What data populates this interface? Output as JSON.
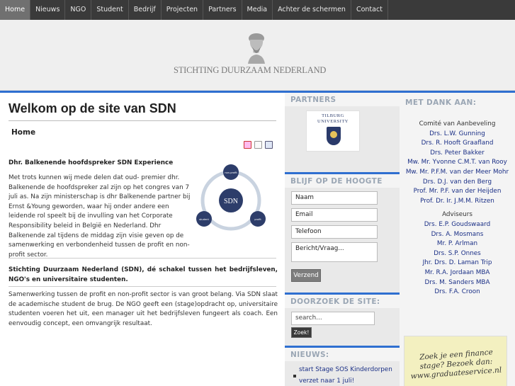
{
  "nav": {
    "items": [
      "Home",
      "Nieuws",
      "NGO",
      "Student",
      "Bedrijf",
      "Projecten",
      "Partners",
      "Media",
      "Achter de schermen",
      "Contact"
    ],
    "active_index": 0
  },
  "header": {
    "logo_text": "STICHTING DUURZAAM NEDERLAND"
  },
  "main": {
    "title": "Welkom op de site van SDN",
    "breadcrumb": "Home",
    "tool_icons": [
      "pdf-icon",
      "print-icon",
      "email-icon"
    ],
    "article_heading": "Dhr. Balkenende hoofdspreker SDN Experience",
    "article_body": "Met trots kunnen wij mede delen dat oud- premier dhr. Balkenende de hoofdspreker zal zijn op het congres van 7 juli as. Na zijn ministerschap is dhr Balkenende partner bij Ernst &Young geworden, waar hij onder andere een leidende rol speelt bij de invulling van het Corporate Responsibility beleid in België en Nederland.  Dhr Balkenende zal tijdens de middag zijn visie geven op de samenwerking en verbondenheid tussen de profit en non-profit sector.",
    "diagram": {
      "center": "SDN",
      "node_top": "non-profit",
      "node_left": "student",
      "node_right": "profit"
    },
    "mission_heading": "Stichting Duurzaam Nederland (SDN), dé schakel tussen het bedrijfsleven, NGO's en universitaire studenten.",
    "mission_body": "Samenwerking tussen de profit en non-profit sector is van groot belang. Via SDN slaat de academische student de brug. De NGO geeft een (stage)opdracht op, universitaire studenten voeren het uit, een manager uit het bedrijfsleven fungeert als coach. Een eenvoudig concept, een omvangrijk resultaat."
  },
  "mid": {
    "partners_head": "PARTNERS",
    "partner_logo": {
      "line1": "TILBURG",
      "line2": "UNIVERSITY"
    },
    "contact_head": "BLIJF OP DE HOOGTE",
    "fields": {
      "name": "Naam",
      "email": "Email",
      "phone": "Telefoon",
      "message": "Bericht/Vraag..."
    },
    "submit": "Verzend",
    "search_head": "DOORZOEK DE SITE:",
    "search_placeholder": "search...",
    "search_button": "Zoek!",
    "news_head": "NIEUWS:",
    "news_items": [
      "start Stage SOS Kinderdorpen",
      "verzet naar 1 juli!"
    ]
  },
  "right": {
    "head": "MET DANK AAN:",
    "committee_head": "Comité van Aanbeveling",
    "committee": [
      "Drs. L.W. Gunning",
      "Drs. R. Hooft Graafland",
      "Drs. Peter Bakker",
      "Mw. Mr. Yvonne C.M.T. van Rooy",
      "Mw. Mr. P.F.M. van der Meer Mohr",
      "Drs. D.J. van den Berg",
      "Prof. Mr. P.F. van der Heijden",
      "Prof. Dr. Ir. J.M.M. Ritzen"
    ],
    "advisors_head": "Adviseurs",
    "advisors": [
      "Drs. E.P. Goudswaard",
      "Drs. A. Mosmans",
      "Mr. P. Arlman",
      "Drs. S.P. Onnes",
      "Jhr. Drs. D. Laman Trip",
      "Mr. R.A. Jordaan MBA",
      "Drs. M. Sanders MBA",
      "Drs. F.A. Croon"
    ],
    "ad": {
      "line1": "Zoek je een finance",
      "line2": "stage? Bezoek dan:",
      "line3": "www.graduateservice.nl"
    }
  },
  "colors": {
    "accent": "#2f6fd0",
    "link": "#1a2f86",
    "nav_bg": "#3a3a3a"
  }
}
